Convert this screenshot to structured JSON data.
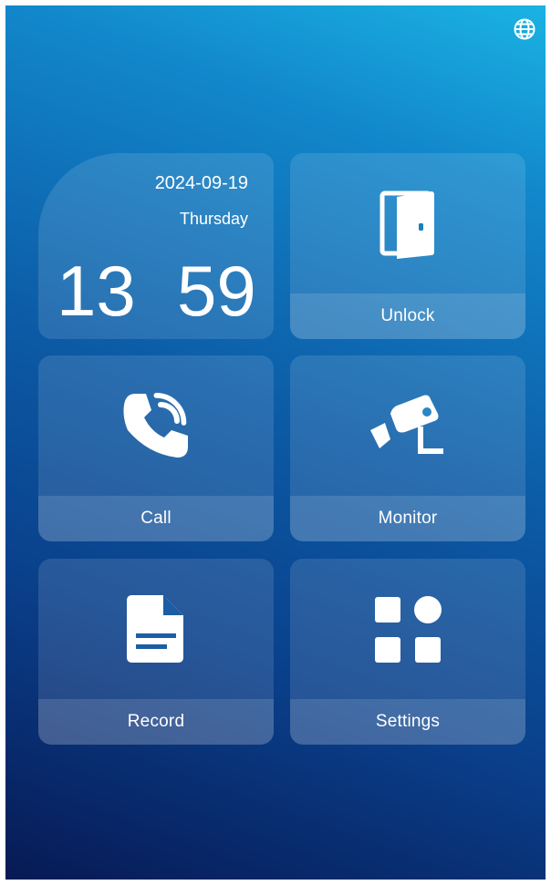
{
  "clock": {
    "date": "2024-09-19",
    "weekday": "Thursday",
    "hour": "13",
    "minute": "59"
  },
  "tiles": [
    {
      "label": "Unlock",
      "icon": "door-icon"
    },
    {
      "label": "Call",
      "icon": "phone-icon"
    },
    {
      "label": "Monitor",
      "icon": "camera-icon"
    },
    {
      "label": "Record",
      "icon": "document-icon"
    },
    {
      "label": "Settings",
      "icon": "grid-apps-icon"
    }
  ],
  "header": {
    "language_icon": "globe-icon"
  },
  "colors": {
    "gradient_top": "#1ab3e3",
    "gradient_bottom": "#071a55",
    "tile_fill": "rgba(255,255,255,0.12)"
  }
}
